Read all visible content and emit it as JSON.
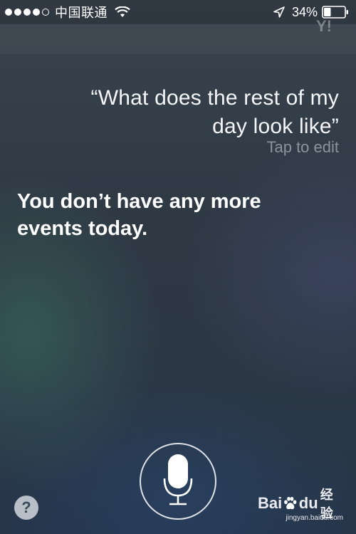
{
  "status_bar": {
    "signal_dots_filled": 4,
    "signal_dots_total": 5,
    "carrier": "中国联通",
    "wifi_icon": "wifi-icon",
    "location_icon": "location-arrow-icon",
    "battery_percent": "34%",
    "battery_level": 0.34
  },
  "header": {
    "partner_logo": "Y!"
  },
  "siri": {
    "query": "“What does the rest of my day look like”",
    "tap_to_edit": "Tap to edit",
    "answer": "You don’t have any more events today."
  },
  "controls": {
    "mic_icon": "microphone-icon",
    "help_label": "?"
  },
  "watermark": {
    "logo_text_left": "Bai",
    "logo_text_right": "du",
    "logo_cn": "经验",
    "url": "jingyan.baidu.com"
  },
  "colors": {
    "text_primary": "#ffffff",
    "text_secondary": "#c8d2da",
    "mic_ring": "#ffffff"
  }
}
